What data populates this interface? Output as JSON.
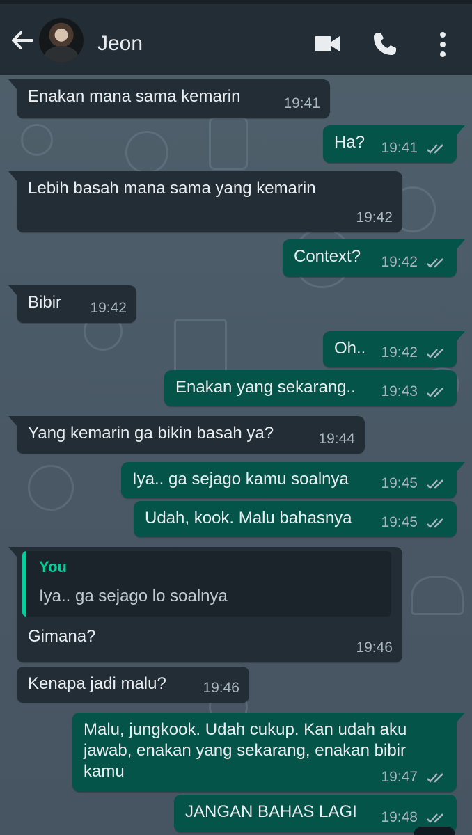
{
  "header": {
    "contact_name": "Jeon",
    "icons": [
      "back-arrow-icon",
      "avatar",
      "video-call-icon",
      "phone-icon",
      "more-vert-icon"
    ]
  },
  "colors": {
    "header_bg": "#232d36",
    "incoming_bubble": "#232d36",
    "outgoing_bubble": "#04544a",
    "quote_accent": "#06cf9c",
    "text": "#e9edef",
    "time": "#a8b6bf",
    "chat_bg": "#4b5b66"
  },
  "messages": [
    {
      "dir": "in",
      "text": "Enakan mana sama kemarin",
      "time": "19:41"
    },
    {
      "dir": "out",
      "text": "Ha?",
      "time": "19:41",
      "status": "read"
    },
    {
      "dir": "in",
      "text": "Lebih basah mana sama yang kemarin",
      "time": "19:42"
    },
    {
      "dir": "out",
      "text": "Context?",
      "time": "19:42",
      "status": "read"
    },
    {
      "dir": "in",
      "text": "Bibir",
      "time": "19:42"
    },
    {
      "dir": "out",
      "text": "Oh..",
      "time": "19:42",
      "status": "read"
    },
    {
      "dir": "out",
      "text": "Enakan yang sekarang..",
      "time": "19:43",
      "status": "read"
    },
    {
      "dir": "in",
      "text": "Yang kemarin ga bikin basah ya?",
      "time": "19:44"
    },
    {
      "dir": "out",
      "text": "Iya.. ga sejago kamu soalnya",
      "time": "19:45",
      "status": "read"
    },
    {
      "dir": "out",
      "text": "Udah, kook. Malu bahasnya",
      "time": "19:45",
      "status": "read"
    },
    {
      "dir": "in",
      "text": "Gimana?",
      "time": "19:46",
      "quote": {
        "author": "You",
        "text": "Iya.. ga sejago lo soalnya"
      }
    },
    {
      "dir": "in",
      "text": "Kenapa jadi malu?",
      "time": "19:46"
    },
    {
      "dir": "out",
      "text": "Malu, jungkook. Udah cukup. Kan udah aku\njawab, enakan yang sekarang, enakan bibir\nkamu",
      "time": "19:47",
      "status": "read"
    },
    {
      "dir": "out",
      "text": "JANGAN BAHAS LAGI",
      "time": "19:48",
      "status": "read"
    }
  ]
}
